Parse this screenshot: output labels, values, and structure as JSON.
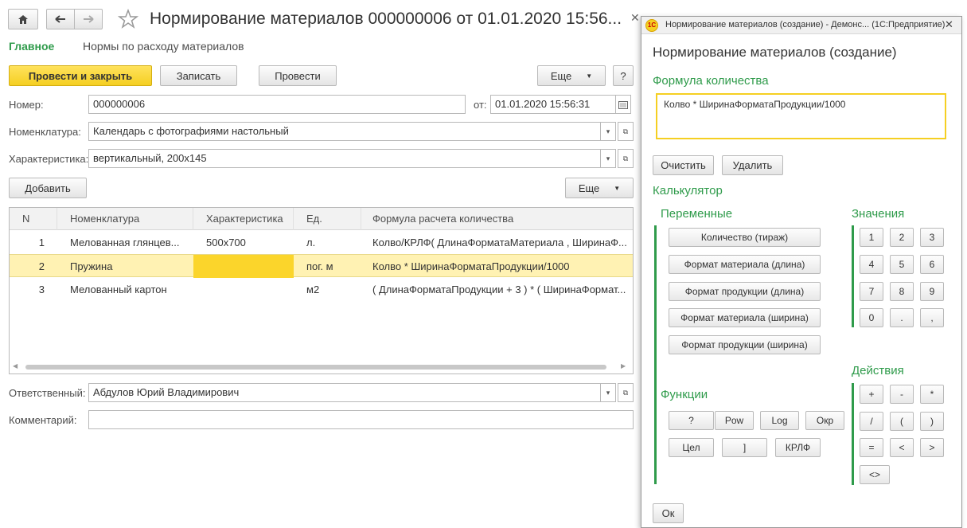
{
  "main": {
    "title": "Нормирование материалов 000000006 от 01.01.2020 15:56...",
    "nav": {
      "main_link": "Главное",
      "norms_link": "Нормы по расходу материалов"
    },
    "toolbar": {
      "post_close": "Провести и закрыть",
      "save": "Записать",
      "post": "Провести",
      "more": "Еще",
      "help": "?"
    },
    "number_label": "Номер:",
    "number_value": "000000006",
    "date_label": "от:",
    "date_value": "01.01.2020 15:56:31",
    "nomenclature_label": "Номенклатура:",
    "nomenclature_value": "Календарь с фотографиями настольный",
    "characteristic_label": "Характеристика:",
    "characteristic_value": "вертикальный, 200x145",
    "add_button": "Добавить",
    "table_more": "Еще",
    "table": {
      "headers": [
        "N",
        "Номенклатура",
        "Характеристика",
        "Ед.",
        "Формула расчета количества"
      ],
      "rows": [
        {
          "n": "1",
          "nomenclature": "Мелованная глянцев...",
          "characteristic": "500x700",
          "unit": "л.",
          "formula": "Колво/КРЛФ(  ДлинаФорматаМатериала , ШиринаФ..."
        },
        {
          "n": "2",
          "nomenclature": "Пружина",
          "characteristic": "",
          "unit": "пог. м",
          "formula": "Колво * ШиринаФорматаПродукции/1000"
        },
        {
          "n": "3",
          "nomenclature": "Мелованный картон",
          "characteristic": "",
          "unit": "м2",
          "formula": "( ДлинаФорматаПродукции + 3 ) * ( ШиринаФормат..."
        }
      ]
    },
    "responsible_label": "Ответственный:",
    "responsible_value": "Абдулов Юрий Владимирович",
    "comment_label": "Комментарий:",
    "comment_value": ""
  },
  "dialog": {
    "window_title": "Нормирование материалов (создание) - Демонс...  (1С:Предприятие)",
    "title": "Нормирование материалов (создание)",
    "formula_section": "Формула количества",
    "formula_value": "Колво * ШиринаФорматаПродукции/1000",
    "clear_button": "Очистить",
    "delete_button": "Удалить",
    "calculator_section": "Калькулятор",
    "variables_section": "Переменные",
    "variables": [
      "Количество (тираж)",
      "Формат материала (длина)",
      "Формат продукции (длина)",
      "Формат материала (ширина)",
      "Формат продукции (ширина)"
    ],
    "values_section": "Значения",
    "digits": [
      "1",
      "2",
      "3",
      "4",
      "5",
      "6",
      "7",
      "8",
      "9",
      "0",
      ".",
      ","
    ],
    "actions_section": "Действия",
    "actions": [
      "+",
      "-",
      "*",
      "/",
      "(",
      ")",
      "=",
      "<",
      ">",
      "<>"
    ],
    "functions_section": "Функции",
    "functions": [
      "?",
      "Pow",
      "Log",
      "Окр",
      "Цел",
      "]",
      "КРЛФ"
    ],
    "ok_button": "Ок"
  },
  "colors": {
    "accent_green": "#2f9b4b",
    "selected_row": "#fff2b3",
    "selected_cell": "#fbd52b",
    "yellow_button": "#f5cf22"
  }
}
